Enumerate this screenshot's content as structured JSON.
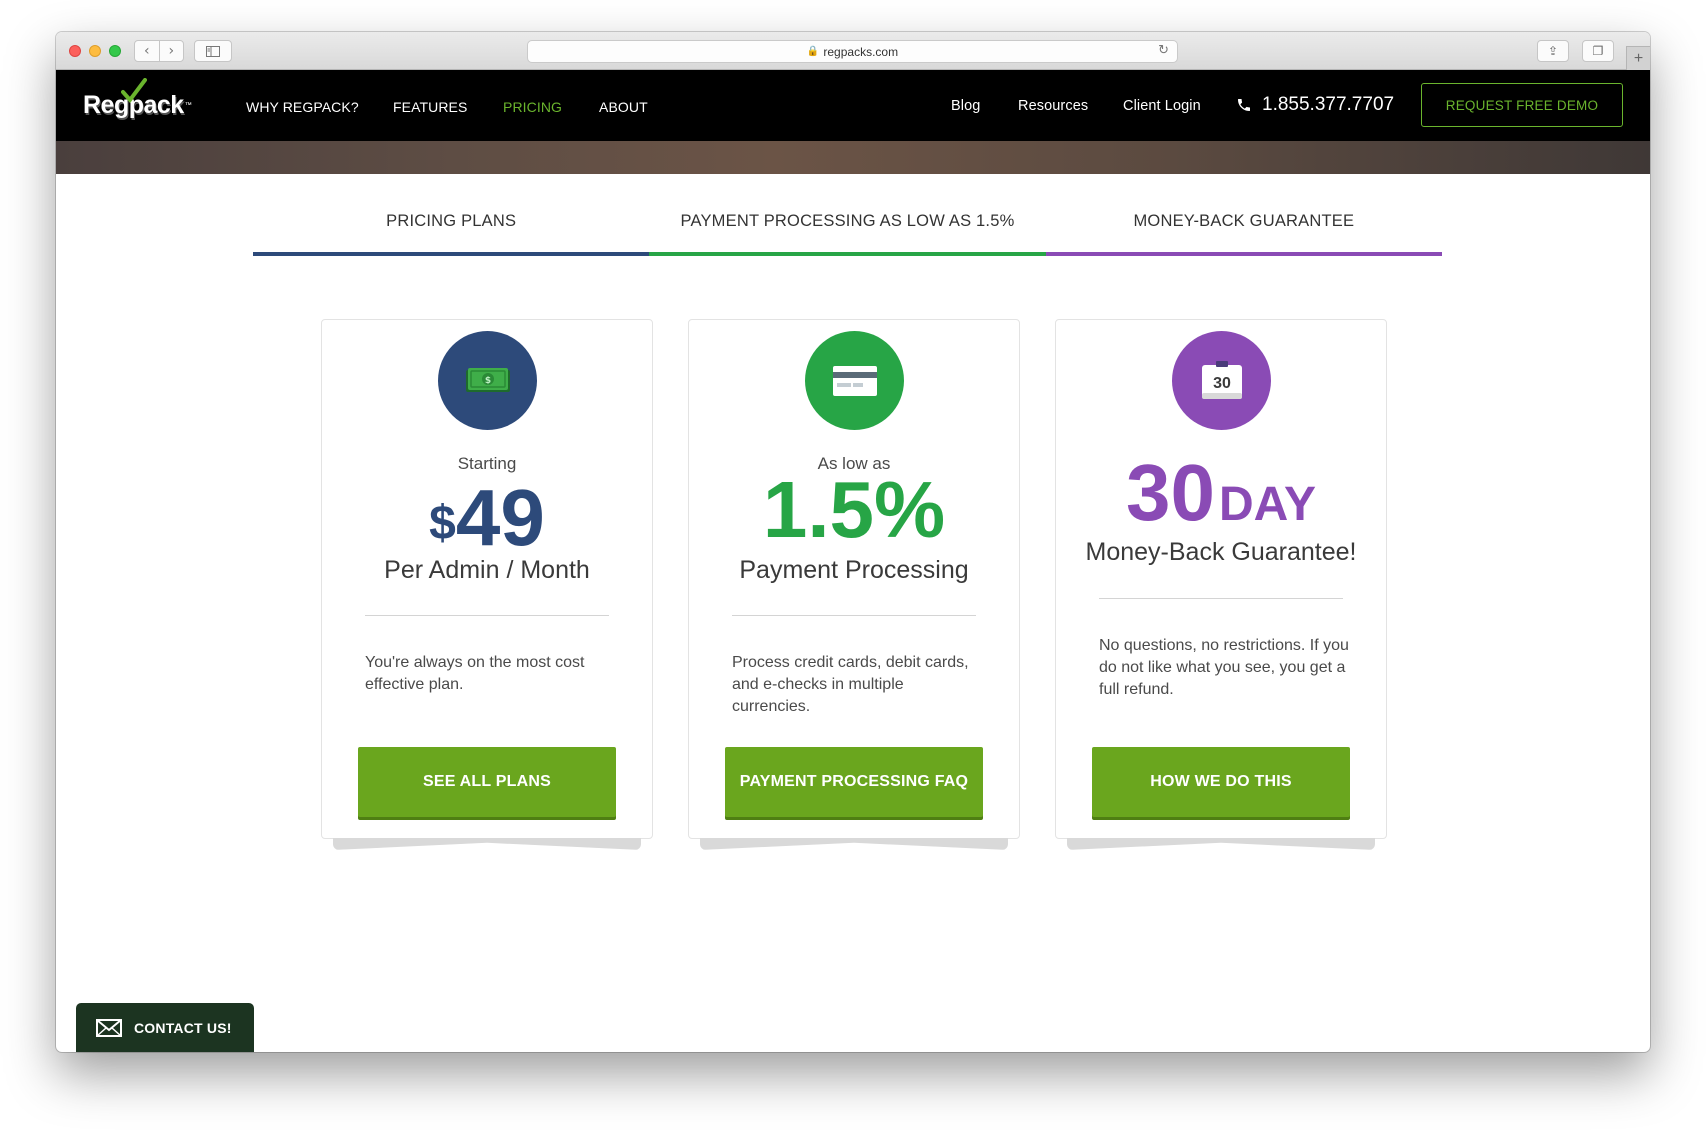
{
  "browser": {
    "url": "regpacks.com",
    "back_icon": "‹",
    "forward_icon": "›",
    "reload_icon": "↻",
    "share_icon": "⇪",
    "tabs_icon": "❐",
    "newtab_icon": "+"
  },
  "nav": {
    "logo": "Regpack",
    "links": [
      {
        "label": "WHY REGPACK?"
      },
      {
        "label": "FEATURES"
      },
      {
        "label": "PRICING",
        "active": true
      },
      {
        "label": "ABOUT"
      }
    ],
    "right_links": [
      {
        "label": "Blog"
      },
      {
        "label": "Resources"
      },
      {
        "label": "Client Login"
      }
    ],
    "phone": "1.855.377.7707",
    "demo_button": "REQUEST FREE DEMO"
  },
  "tabs": [
    {
      "label": "PRICING PLANS",
      "color": "#2d4a7a"
    },
    {
      "label": "PAYMENT PROCESSING AS LOW AS 1.5%",
      "color": "#27a546"
    },
    {
      "label": "MONEY-BACK GUARANTEE",
      "color": "#8a4bb5"
    }
  ],
  "cards": [
    {
      "icon": "money-icon",
      "color": "#2d4a7a",
      "lead": "Starting",
      "currency": "$",
      "amount": "49",
      "subtitle": "Per Admin / Month",
      "description": "You're always on the most cost effective plan.",
      "button": "SEE ALL PLANS"
    },
    {
      "icon": "credit-card-icon",
      "color": "#27a546",
      "lead": "As low as",
      "amount": "1.5%",
      "subtitle": "Payment Processing",
      "description": "Process credit cards, debit cards, and e-checks in multiple currencies.",
      "button": "PAYMENT PROCESSING FAQ"
    },
    {
      "icon": "calendar-icon",
      "color": "#8a4bb5",
      "calendar_number": "30",
      "amount": "30",
      "unit": "DAY",
      "subtitle": "Money-Back Guarantee!",
      "description": "No questions, no restrictions. If you do not like what you see, you get a full refund.",
      "button": "HOW WE DO THIS"
    }
  ],
  "contact": {
    "label": "CONTACT US!"
  },
  "colors": {
    "accent": "#6ab42d",
    "button": "#6aa61e",
    "nav_bg": "#000000"
  }
}
